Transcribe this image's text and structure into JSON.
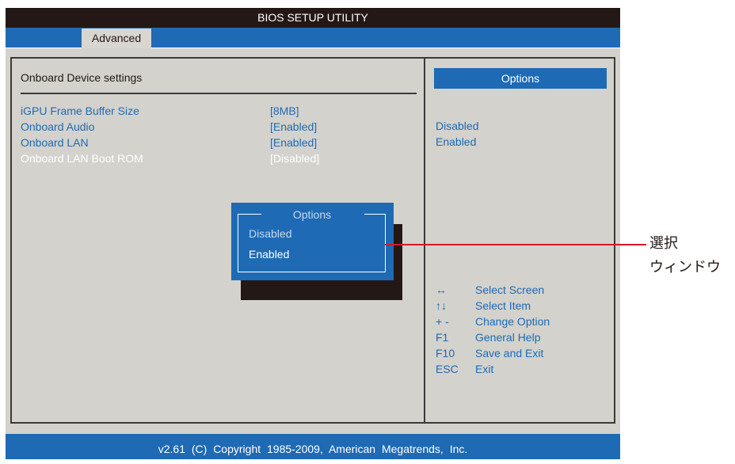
{
  "window": {
    "title": "BIOS SETUP UTILITY"
  },
  "tabs": [
    {
      "label": "Advanced"
    }
  ],
  "section": {
    "title": "Onboard Device settings"
  },
  "settings": [
    {
      "label": "iGPU Frame Buffer Size",
      "value": "[8MB]"
    },
    {
      "label": "Onboard Audio",
      "value": "[Enabled]"
    },
    {
      "label": "Onboard LAN",
      "value": "[Enabled]"
    },
    {
      "label": "Onboard LAN Boot ROM",
      "value": "[Disabled]"
    }
  ],
  "help_panel": {
    "title": "Options",
    "options": [
      "Disabled",
      "Enabled"
    ]
  },
  "keys": [
    {
      "key": "↔",
      "desc": "Select Screen"
    },
    {
      "key": "↑↓",
      "desc": "Select Item"
    },
    {
      "key": "+ -",
      "desc": "Change Option"
    },
    {
      "key": "F1",
      "desc": "General Help"
    },
    {
      "key": "F10",
      "desc": "Save and Exit"
    },
    {
      "key": "ESC",
      "desc": "Exit"
    }
  ],
  "popup": {
    "title": "Options",
    "items": [
      "Disabled",
      "Enabled"
    ]
  },
  "footer": {
    "text": "v2.61 (C) Copyright 1985-2009, American Megatrends, Inc."
  },
  "callout": {
    "line1": "選択",
    "line2": "ウィンドウ"
  },
  "colors": {
    "accent": "#1e6ab4",
    "panel": "#d3d2cd",
    "callout": "#d7182a"
  }
}
